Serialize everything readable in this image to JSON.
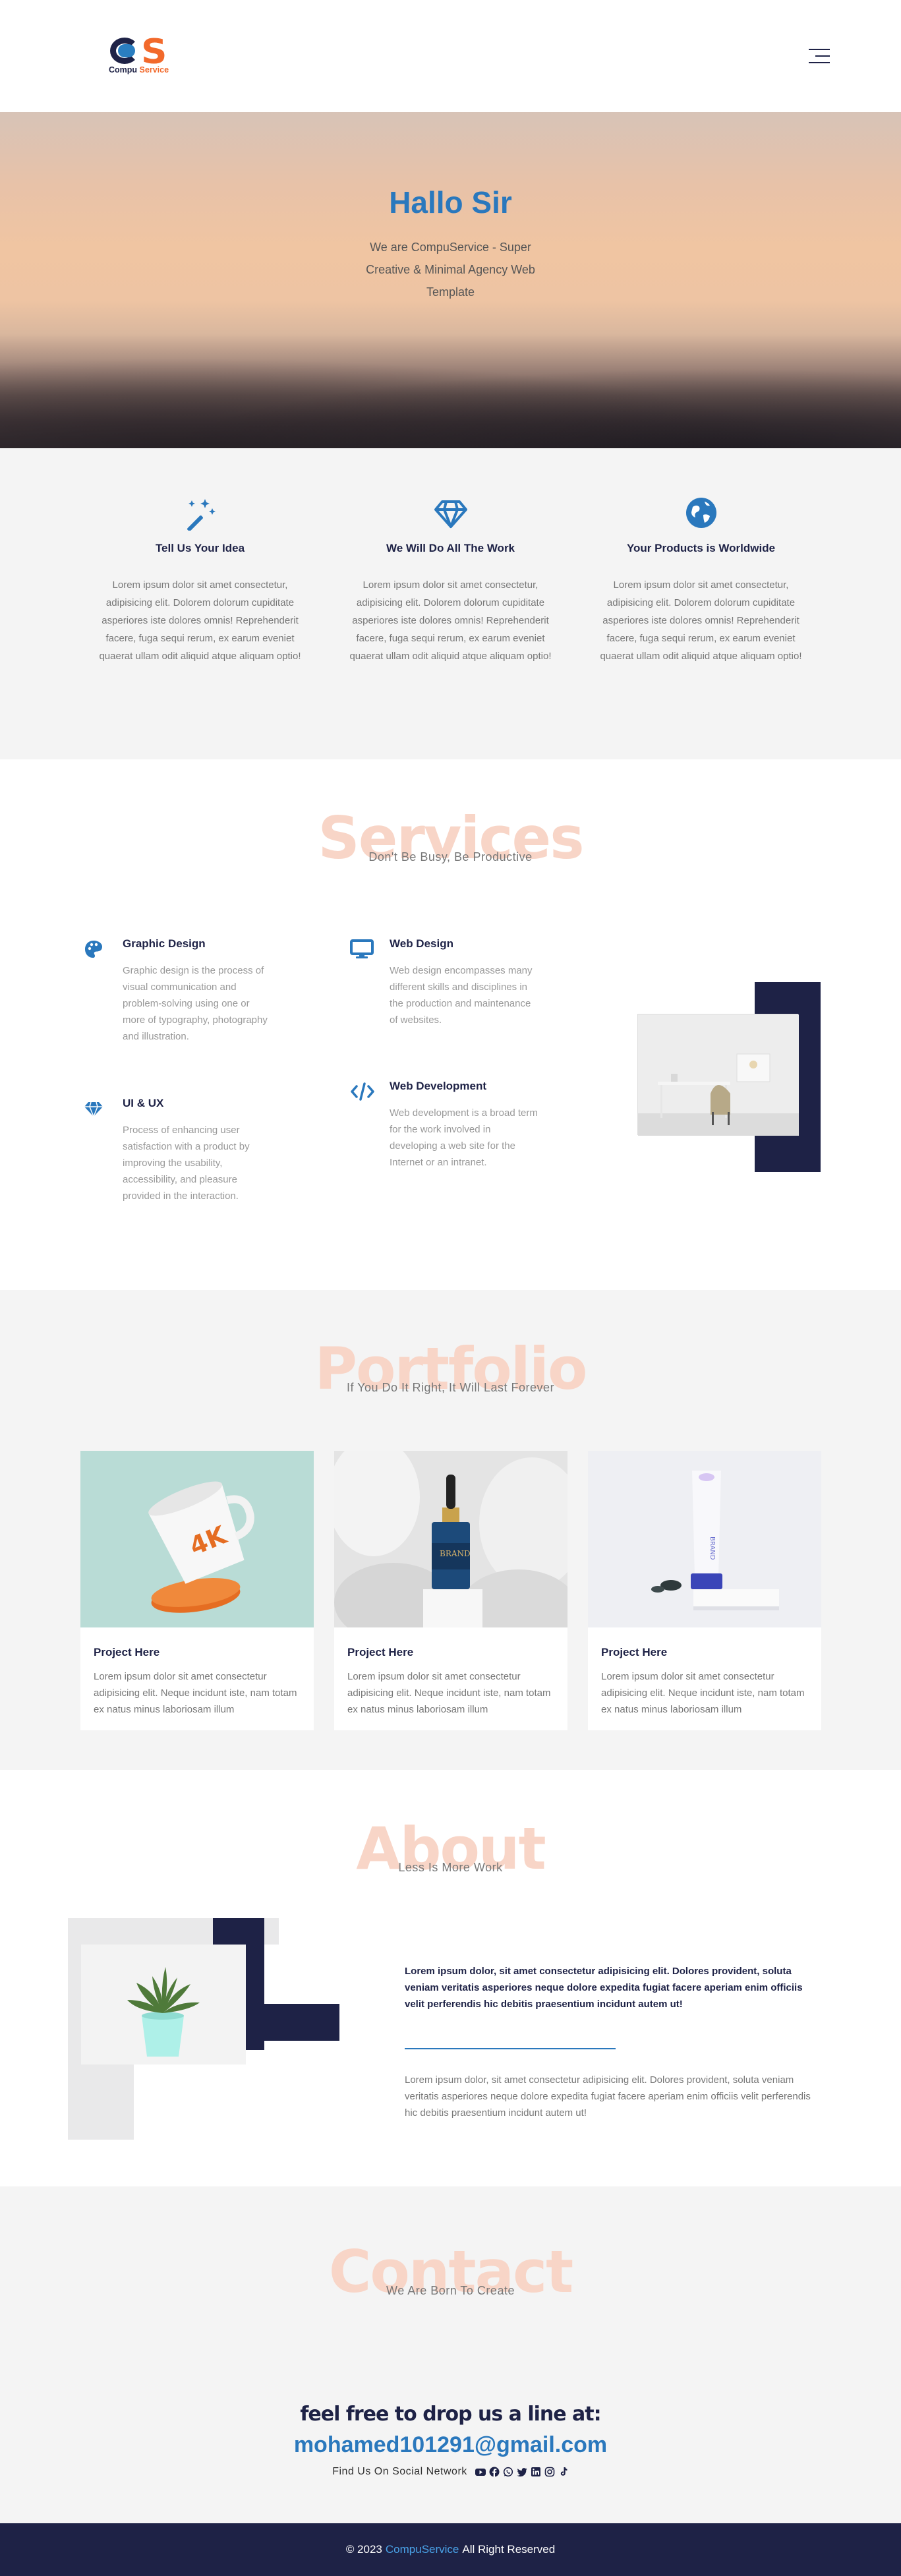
{
  "header": {
    "logo_text_part1": "Compu",
    "logo_text_part2": "Service",
    "menu_icon": "hamburger-icon"
  },
  "hero": {
    "title": "Hallo Sir",
    "subtitle": "We are CompuService - Super Creative & Minimal Agency Web Template"
  },
  "features": [
    {
      "icon": "magic-wand-icon",
      "title": "Tell Us Your Idea",
      "text": "Lorem ipsum dolor sit amet consectetur, adipisicing elit. Dolorem dolorum cupiditate asperiores iste dolores omnis! Reprehenderit facere, fuga sequi rerum, ex earum eveniet quaerat ullam odit aliquid atque aliquam optio!"
    },
    {
      "icon": "diamond-icon",
      "title": "We Will Do All The Work",
      "text": "Lorem ipsum dolor sit amet consectetur, adipisicing elit. Dolorem dolorum cupiditate asperiores iste dolores omnis! Reprehenderit facere, fuga sequi rerum, ex earum eveniet quaerat ullam odit aliquid atque aliquam optio!"
    },
    {
      "icon": "globe-icon",
      "title": "Your Products is Worldwide",
      "text": "Lorem ipsum dolor sit amet consectetur, adipisicing elit. Dolorem dolorum cupiditate asperiores iste dolores omnis! Reprehenderit facere, fuga sequi rerum, ex earum eveniet quaerat ullam odit aliquid atque aliquam optio!"
    }
  ],
  "services": {
    "heading": "Services",
    "subheading": "Don't Be Busy, Be Productive",
    "items": [
      {
        "icon": "palette-icon",
        "title": "Graphic Design",
        "text": "Graphic design is the process of visual communication and problem-solving using one or more of typography, photography and illustration."
      },
      {
        "icon": "monitor-icon",
        "title": "Web Design",
        "text": "Web design encompasses many different skills and disciplines in the production and maintenance of websites."
      },
      {
        "icon": "gem-icon",
        "title": "UI & UX",
        "text": "Process of enhancing user satisfaction with a product by improving the usability, accessibility, and pleasure provided in the interaction."
      },
      {
        "icon": "code-icon",
        "title": "Web Development",
        "text": "Web development is a broad term for the work involved in developing a web site for the Internet or an intranet."
      }
    ]
  },
  "portfolio": {
    "heading": "Portfolio",
    "subheading": "If You Do It Right, It Will Last Forever",
    "cards": [
      {
        "title": "Project Here",
        "text": "Lorem ipsum dolor sit amet consectetur adipisicing elit. Neque incidunt iste, nam totam ex natus minus laboriosam illum"
      },
      {
        "title": "Project Here",
        "text": "Lorem ipsum dolor sit amet consectetur adipisicing elit. Neque incidunt iste, nam totam ex natus minus laboriosam illum"
      },
      {
        "title": "Project Here",
        "text": "Lorem ipsum dolor sit amet consectetur adipisicing elit. Neque incidunt iste, nam totam ex natus minus laboriosam illum"
      }
    ]
  },
  "about": {
    "heading": "About",
    "subheading": "Less Is More Work",
    "bold_text": "Lorem ipsum dolor, sit amet consectetur adipisicing elit. Dolores provident, soluta veniam veritatis asperiores neque dolore expedita fugiat facere aperiam enim officiis velit perferendis hic debitis praesentium incidunt autem ut!",
    "normal_text": "Lorem ipsum dolor, sit amet consectetur adipisicing elit. Dolores provident, soluta veniam veritatis asperiores neque dolore expedita fugiat facere aperiam enim officiis velit perferendis hic debitis praesentium incidunt autem ut!"
  },
  "contact": {
    "heading": "Contact",
    "subheading": "We Are Born To Create",
    "drop_line": "feel free to drop us a line at:",
    "email": "mohamed101291@gmail.com",
    "social_label": "Find Us On Social Network",
    "social_icons": [
      "youtube-icon",
      "facebook-icon",
      "whatsapp-icon",
      "twitter-icon",
      "linkedin-icon",
      "instagram-icon",
      "tiktok-icon"
    ]
  },
  "footer": {
    "copyright": "© 2023",
    "brand": "CompuService",
    "rights": "All Right Reserved"
  },
  "colors": {
    "navy": "#1e2246",
    "blue": "#2a78bd",
    "orange": "#f2692b",
    "peach": "#f8d5c7"
  }
}
